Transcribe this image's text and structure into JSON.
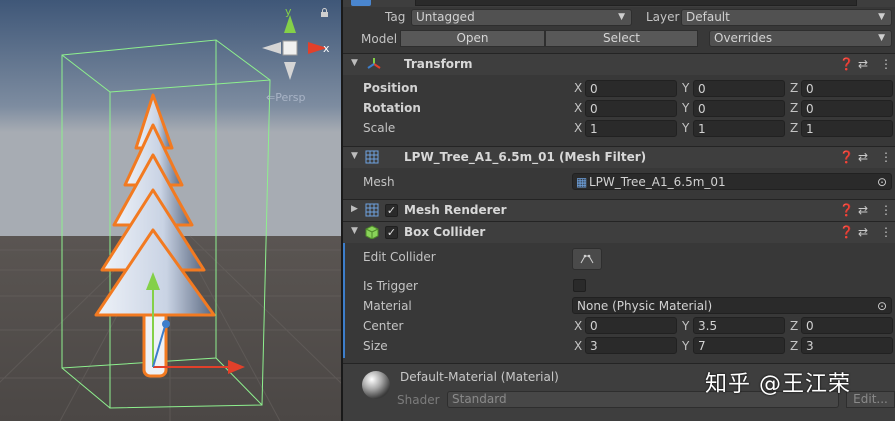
{
  "scene": {
    "persp_label": "Persp",
    "gizmo_y": "y",
    "gizmo_x": "x"
  },
  "header": {
    "tag_label": "Tag",
    "tag_value": "Untagged",
    "layer_label": "Layer",
    "layer_value": "Default",
    "model_label": "Model",
    "open_btn": "Open",
    "select_btn": "Select",
    "overrides": "Overrides"
  },
  "transform": {
    "title": "Transform",
    "rows": [
      {
        "label": "Position",
        "x": "0",
        "y": "0",
        "z": "0"
      },
      {
        "label": "Rotation",
        "x": "0",
        "y": "0",
        "z": "0"
      },
      {
        "label": "Scale",
        "x": "1",
        "y": "1",
        "z": "1"
      }
    ]
  },
  "axes": {
    "x": "X",
    "y": "Y",
    "z": "Z"
  },
  "mesh_filter": {
    "title": "LPW_Tree_A1_6.5m_01 (Mesh Filter)",
    "mesh_label": "Mesh",
    "mesh_value": "LPW_Tree_A1_6.5m_01"
  },
  "mesh_renderer": {
    "title": "Mesh Renderer",
    "enabled": "✓"
  },
  "box_collider": {
    "title": "Box Collider",
    "enabled": "✓",
    "edit_collider_label": "Edit Collider",
    "is_trigger_label": "Is Trigger",
    "material_label": "Material",
    "material_value": "None (Physic Material)",
    "center_label": "Center",
    "center": {
      "x": "0",
      "y": "3.5",
      "z": "0"
    },
    "size_label": "Size",
    "size": {
      "x": "3",
      "y": "7",
      "z": "3"
    }
  },
  "material": {
    "name": "Default-Material (Material)",
    "shader_label": "Shader",
    "shader_value": "Standard",
    "edit_btn": "Edit..."
  },
  "watermark": "知乎 @王江荣",
  "colors": {
    "selection_outline": "#f27a21",
    "collider_green": "#8ef08e",
    "accent_blue": "#3d7ecb"
  }
}
